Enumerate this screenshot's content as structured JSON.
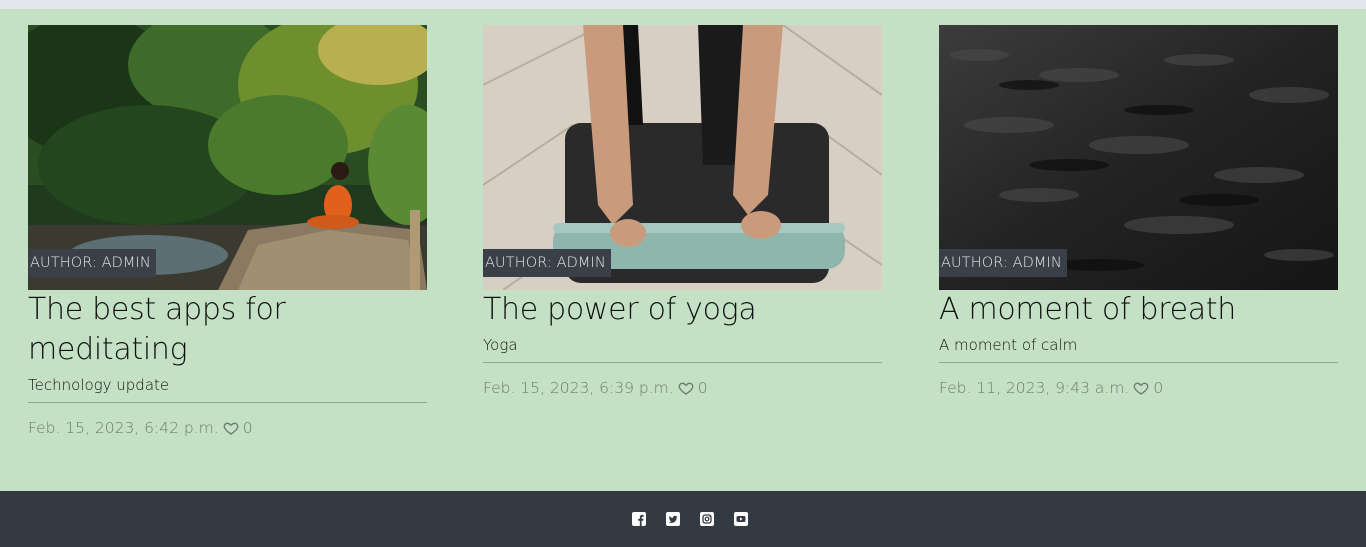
{
  "posts": [
    {
      "author": "AUTHOR: ADMIN",
      "title": "The best apps for meditating",
      "subtitle": "Technology update",
      "date": "Feb. 15, 2023, 6:42 p.m.",
      "likes": "0",
      "image_alt": "woman meditating on rock by forest stream"
    },
    {
      "author": "AUTHOR: ADMIN",
      "title": "The power of yoga",
      "subtitle": "Yoga",
      "date": "Feb. 15, 2023, 6:39 p.m.",
      "likes": "0",
      "image_alt": "person rolling yoga mat on wooden floor"
    },
    {
      "author": "AUTHOR: ADMIN",
      "title": "A moment of breath",
      "subtitle": "A moment of calm",
      "date": "Feb. 11, 2023, 9:43 a.m.",
      "likes": "0",
      "image_alt": "dark textured sand surface"
    }
  ],
  "footer": {
    "social_icons": [
      "facebook-icon",
      "twitter-icon",
      "instagram-icon",
      "youtube-icon"
    ]
  },
  "colors": {
    "background": "#c5e1c5",
    "footer": "#343a41",
    "author_tag": "#3a3f48",
    "meta_text": "#6c7a72"
  }
}
